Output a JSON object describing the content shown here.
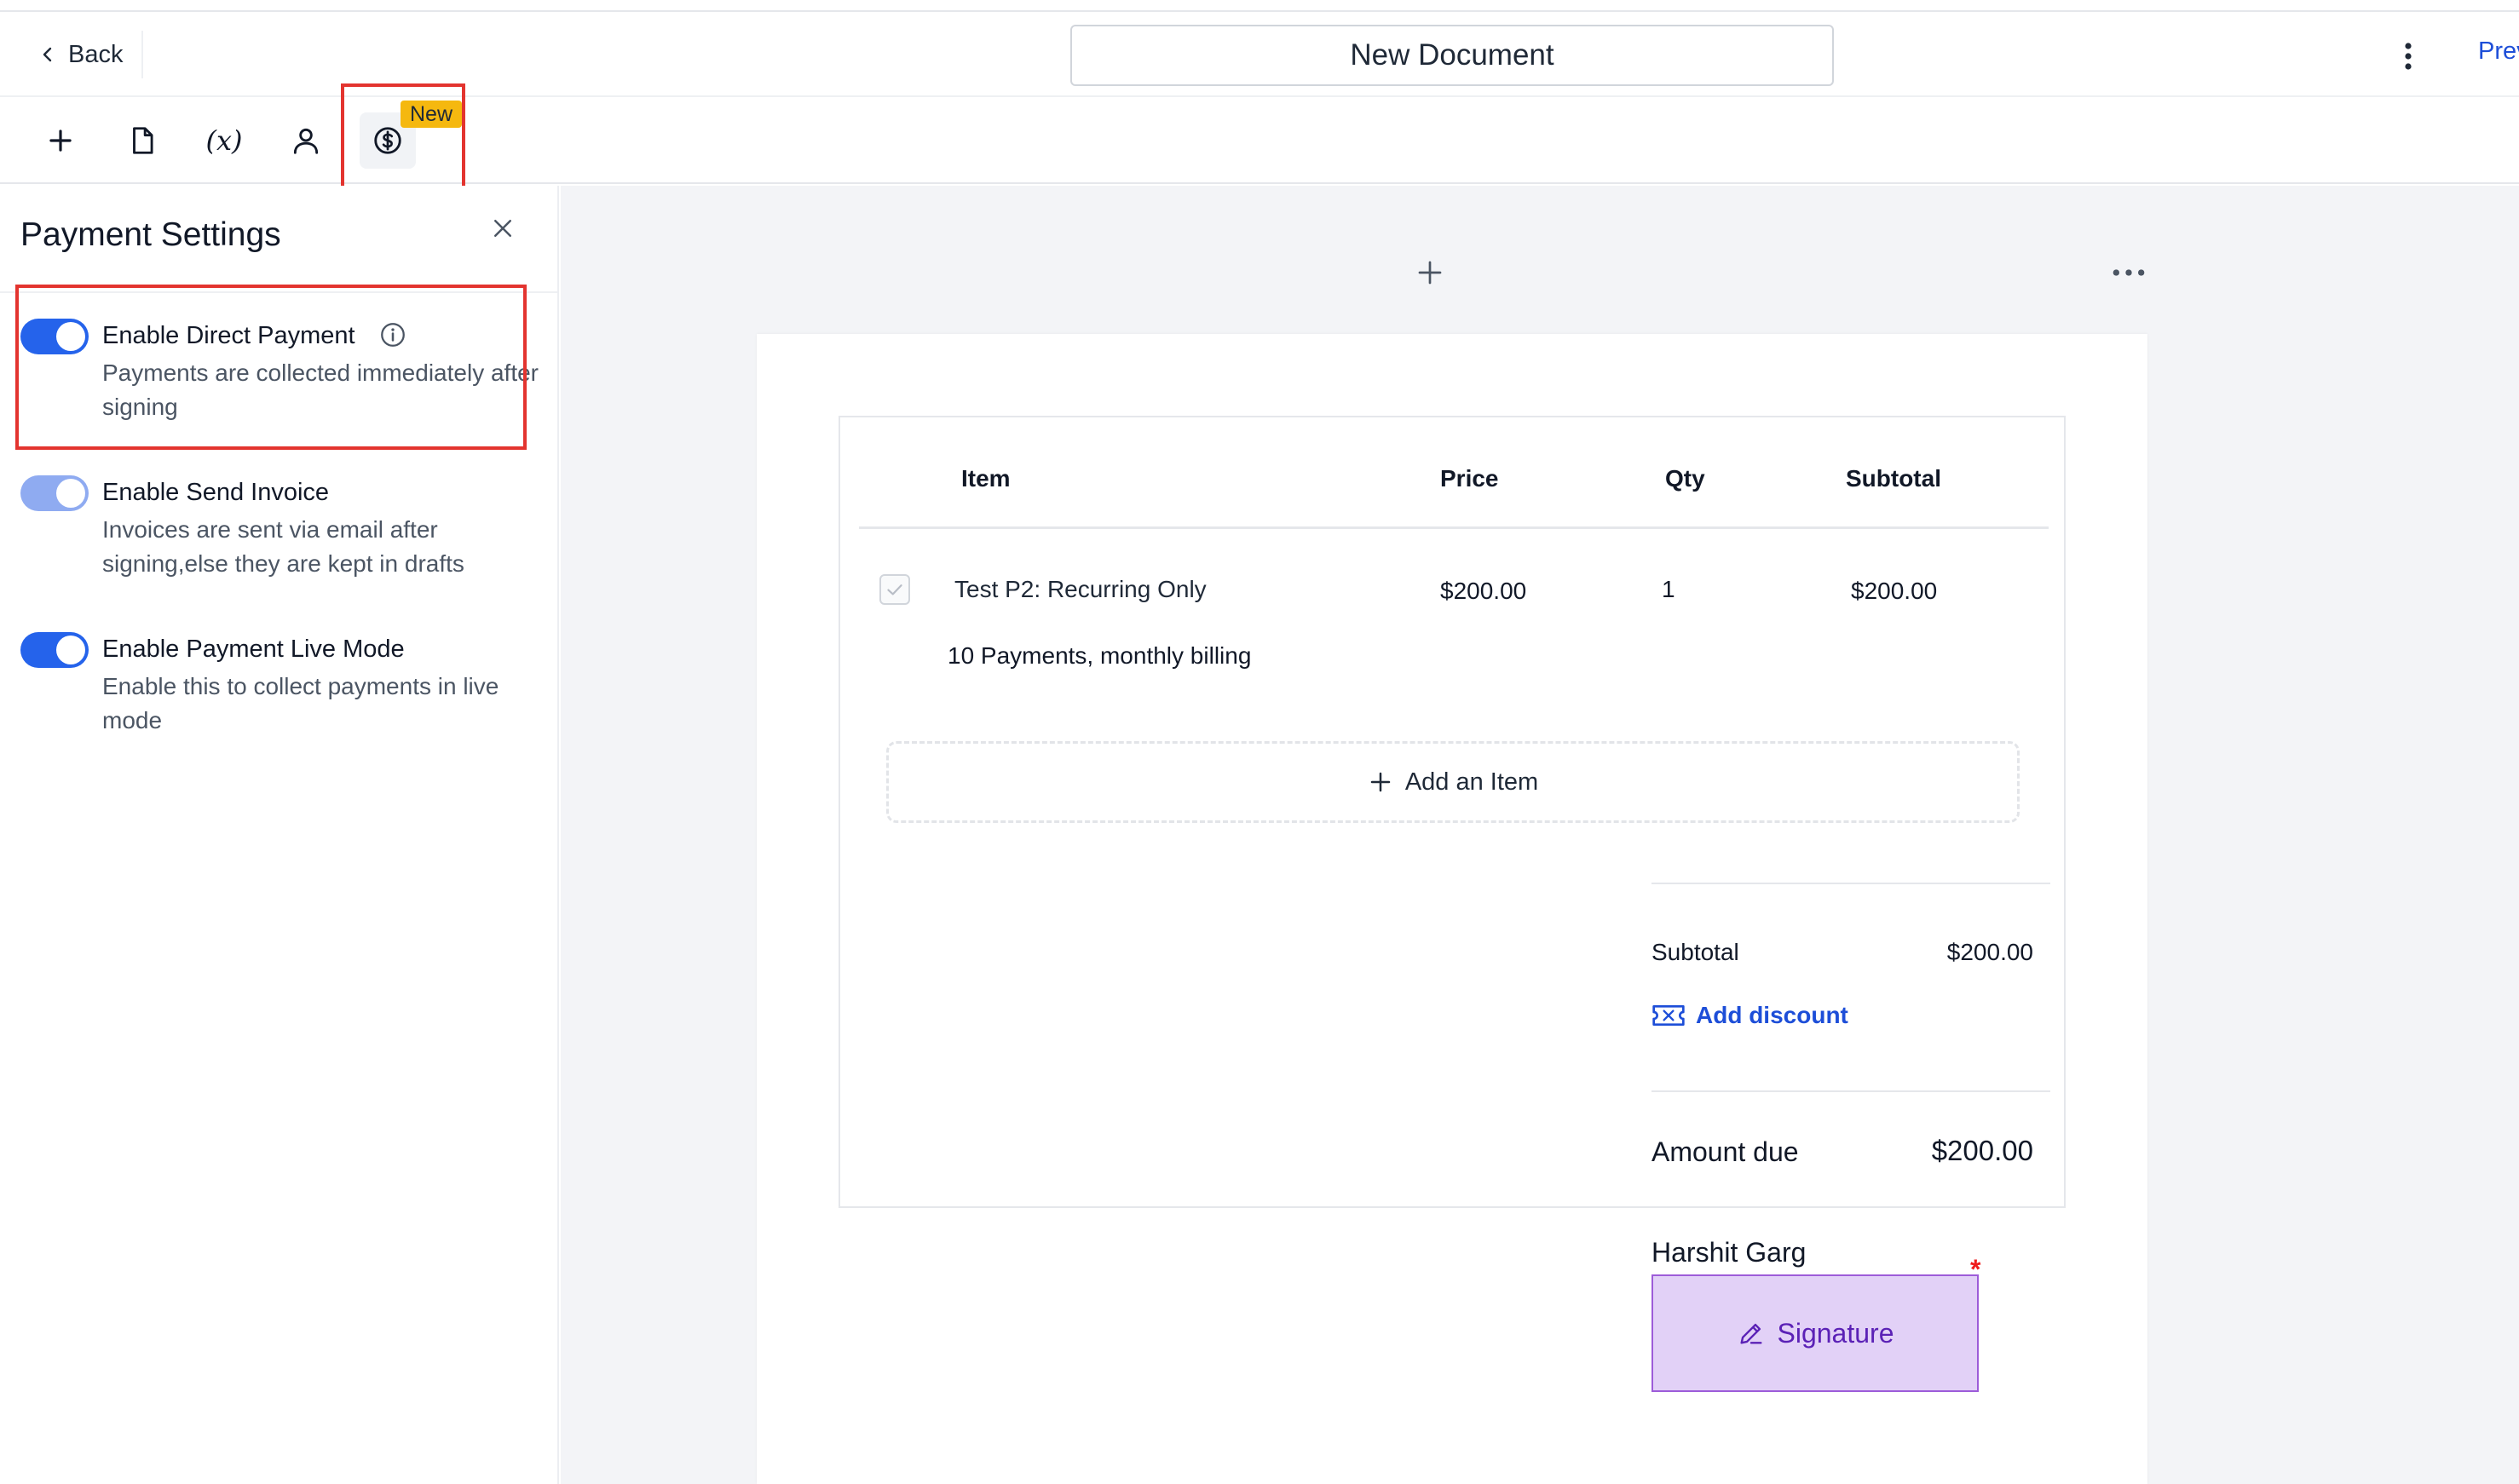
{
  "header": {
    "back_label": "Back",
    "document_title": "New Document",
    "preview_label": "Preview"
  },
  "toolbar": {
    "tools": [
      "add-icon",
      "document-icon",
      "variable-icon",
      "user-icon",
      "dollar-coin-icon"
    ],
    "variable_glyph": "(x)",
    "new_badge": "New"
  },
  "panel": {
    "title": "Payment Settings",
    "settings": [
      {
        "label": "Enable Direct Payment",
        "description": "Payments are collected immediately after signing",
        "enabled": true
      },
      {
        "label": "Enable Send Invoice",
        "description": "Invoices are sent via email after signing,else they are kept in drafts",
        "enabled": true
      },
      {
        "label": "Enable Payment Live Mode",
        "description": "Enable this to collect payments in live mode",
        "enabled": true
      }
    ]
  },
  "table": {
    "headers": {
      "item": "Item",
      "price": "Price",
      "qty": "Qty",
      "subtotal": "Subtotal"
    },
    "rows": [
      {
        "name": "Test P2: Recurring Only",
        "price": "$200.00",
        "qty": "1",
        "subtotal": "$200.00",
        "description": "10 Payments, monthly billing"
      }
    ],
    "add_item_label": "Add an Item"
  },
  "summary": {
    "subtotal_label": "Subtotal",
    "subtotal_value": "$200.00",
    "add_discount_label": "Add discount",
    "amount_due_label": "Amount due",
    "amount_due_value": "$200.00"
  },
  "signer": {
    "name": "Harshit Garg",
    "required_mark": "*",
    "signature_label": "Signature"
  },
  "colors": {
    "accent": "#2563eb",
    "highlight": "#e3342f",
    "badge": "#f5b80f",
    "signature_bg": "#e2d1f7"
  }
}
